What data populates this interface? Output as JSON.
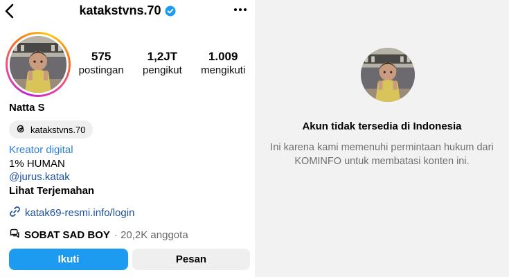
{
  "profile": {
    "username": "katakstvns.70",
    "display_name": "Natta S",
    "threads_handle": "katakstvns.70",
    "stats": [
      {
        "number": "575",
        "label": "postingan"
      },
      {
        "number": "1,2JT",
        "label": "pengikut"
      },
      {
        "number": "1.009",
        "label": "mengikuti"
      }
    ],
    "bio": {
      "category": "Kreator digital",
      "line1": "1% HUMAN",
      "mention": "@jurus.katak",
      "translate": "Lihat Terjemahan"
    },
    "link": "katak69-resmi.info/login",
    "community": {
      "name": "SOBAT SAD BOY",
      "count": "· 20,2K anggota"
    },
    "buttons": {
      "follow": "Ikuti",
      "message": "Pesan"
    }
  },
  "unavailable": {
    "title": "Akun tidak tersedia di Indonesia",
    "message": "Ini karena kami memenuhi permintaan hukum dari KOMINFO untuk membatasi konten ini."
  },
  "colors": {
    "accent": "#1d9bf0",
    "link": "#1b4f9c",
    "verified": "#1d9bf0"
  }
}
